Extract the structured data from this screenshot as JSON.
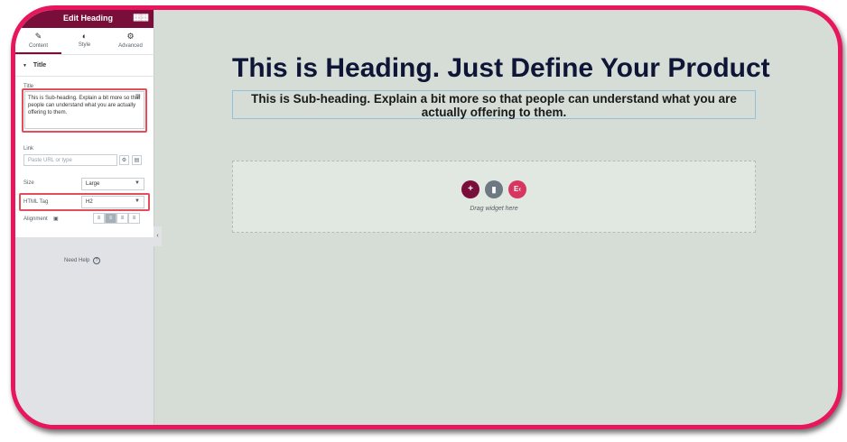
{
  "panel": {
    "title": "Edit Heading",
    "tabs": [
      {
        "label": "Content",
        "icon": "pencil-icon"
      },
      {
        "label": "Style",
        "icon": "contrast-icon"
      },
      {
        "label": "Advanced",
        "icon": "gear-icon"
      }
    ],
    "section_title": "Title",
    "title_label": "Title",
    "title_value": "This is Sub-heading. Explain a bit more so that people can understand what you are actually offering to them.",
    "link_label": "Link",
    "link_placeholder": "Paste URL or type",
    "size_label": "Size",
    "size_value": "Large",
    "html_tag_label": "HTML Tag",
    "html_tag_value": "H2",
    "alignment_label": "Alignment",
    "need_help": "Need Help"
  },
  "canvas": {
    "heading": "This is Heading. Just Define Your Product",
    "subheading": "This is Sub-heading. Explain a bit more so that people can understand what you are actually offering to them.",
    "drop_text": "Drag widget here"
  },
  "colors": {
    "frame_border": "#e8175d",
    "panel_header": "#7a0e3a",
    "canvas_bg": "#d6ddd6",
    "heading_text": "#0f1536",
    "add_button": "#7a0e3a",
    "folder_button": "#6d7882",
    "elementor_button": "#d63660"
  }
}
